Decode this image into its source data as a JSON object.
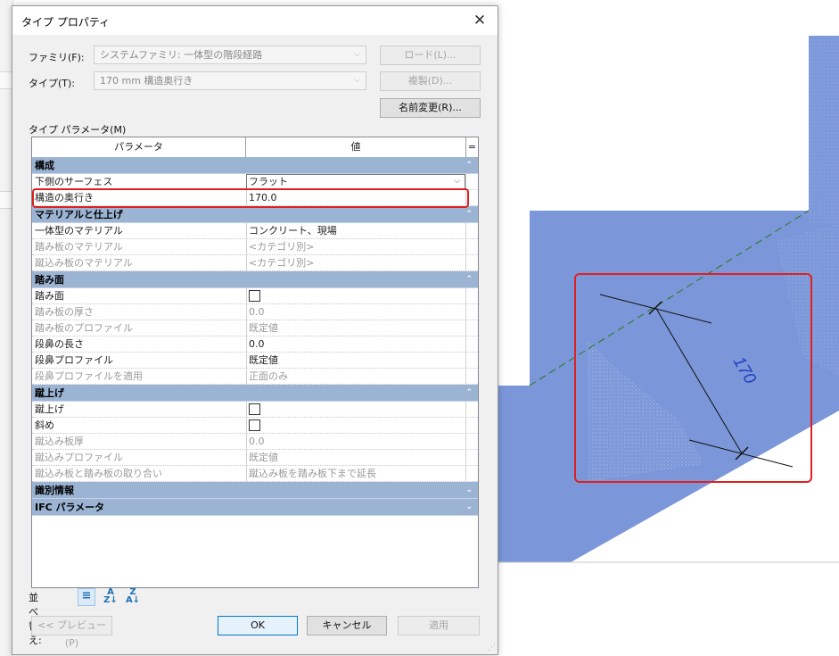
{
  "dialog": {
    "title": "タイプ プロパティ",
    "family_label": "ファミリ(F):",
    "family_value": "システムファミリ: 一体型の階段経路",
    "type_label": "タイプ(T):",
    "type_value": "170 mm 構造奥行き",
    "load_button": "ロード(L)...",
    "duplicate_button": "複製(D)...",
    "rename_button": "名前変更(R)...",
    "type_params_label": "タイプ パラメータ(M)"
  },
  "grid": {
    "headers": [
      "パラメータ",
      "値",
      "="
    ],
    "groups": [
      {
        "name": "構成",
        "rows": [
          {
            "name": "下側のサーフェス",
            "value": "フラット",
            "type": "select"
          },
          {
            "name": "構造の奥行き",
            "value": "170.0",
            "type": "text",
            "highlighted": true
          }
        ]
      },
      {
        "name": "マテリアルと仕上げ",
        "rows": [
          {
            "name": "一体型のマテリアル",
            "value": "コンクリート、現場",
            "type": "text"
          },
          {
            "name": "踏み板のマテリアル",
            "value": "<カテゴリ別>",
            "type": "text",
            "dim": true
          },
          {
            "name": "蹴込み板のマテリアル",
            "value": "<カテゴリ別>",
            "type": "text",
            "dim": true
          }
        ]
      },
      {
        "name": "踏み面",
        "rows": [
          {
            "name": "踏み面",
            "value": "",
            "type": "checkbox"
          },
          {
            "name": "踏み板の厚さ",
            "value": "0.0",
            "type": "text",
            "dim": true
          },
          {
            "name": "踏み板のプロファイル",
            "value": "既定値",
            "type": "text",
            "dim": true
          },
          {
            "name": "段鼻の長さ",
            "value": "0.0",
            "type": "text"
          },
          {
            "name": "段鼻プロファイル",
            "value": "既定値",
            "type": "text"
          },
          {
            "name": "段鼻プロファイルを適用",
            "value": "正面のみ",
            "type": "text",
            "dim": true
          }
        ]
      },
      {
        "name": "蹴上げ",
        "rows": [
          {
            "name": "蹴上げ",
            "value": "",
            "type": "checkbox"
          },
          {
            "name": "斜め",
            "value": "",
            "type": "checkbox"
          },
          {
            "name": "蹴込み板厚",
            "value": "0.0",
            "type": "text",
            "dim": true
          },
          {
            "name": "蹴込みプロファイル",
            "value": "既定値",
            "type": "text",
            "dim": true
          },
          {
            "name": "蹴込み板と踏み板の取り合い",
            "value": "蹴込み板を踏み板下まで延長",
            "type": "text",
            "dim": true
          }
        ]
      },
      {
        "name": "識別情報",
        "rows": []
      },
      {
        "name": "IFC パラメータ",
        "rows": []
      }
    ]
  },
  "footer": {
    "sort_label": "並べ替え:",
    "preview_button": "<< プレビュー(P)",
    "ok_button": "OK",
    "cancel_button": "キャンセル",
    "apply_button": "適用"
  },
  "drawing": {
    "dimension_text": "170",
    "fill_color": "#7b97d9",
    "highlight_color": "#e02020"
  }
}
